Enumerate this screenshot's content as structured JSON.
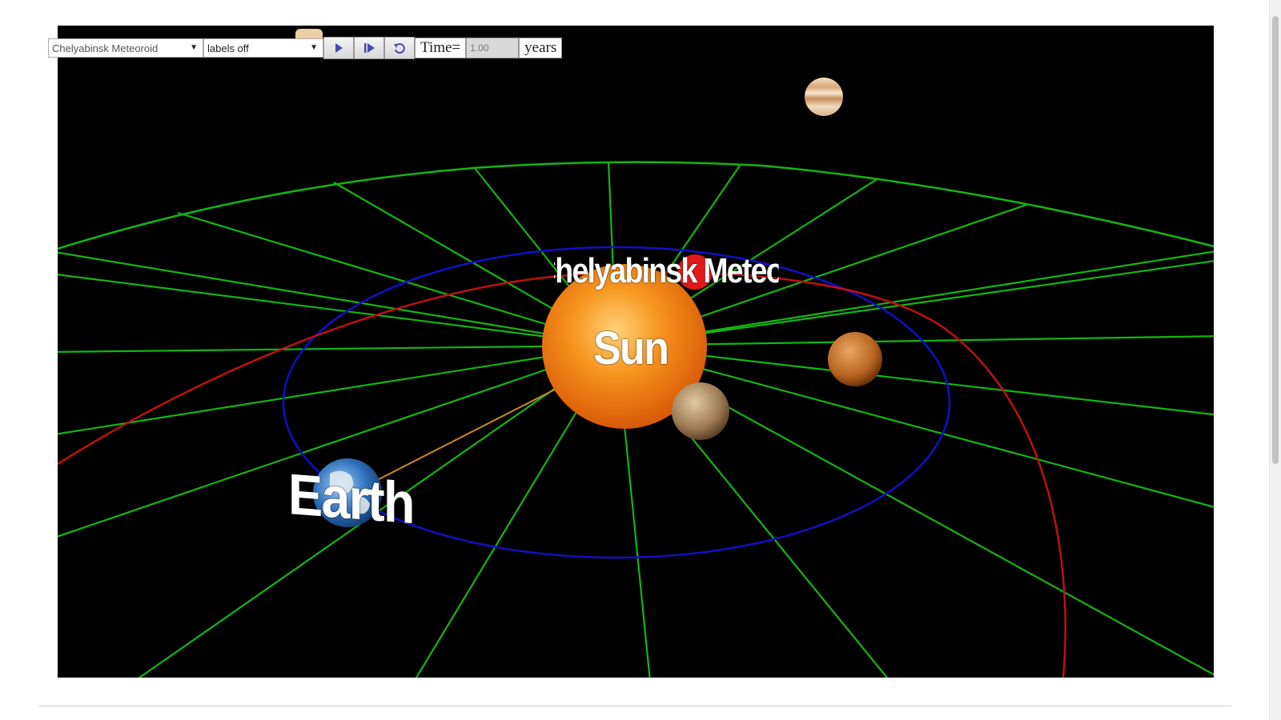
{
  "toolbar": {
    "body_select": {
      "value": "Chelyabinsk Meteoroid"
    },
    "labels_select": {
      "value": "labels off"
    },
    "play_icon": "play-icon",
    "step_icon": "step-icon",
    "reset_icon": "reset-icon",
    "time_label": "Time=",
    "time_value": "1.00",
    "time_unit": "years"
  },
  "scene": {
    "labels": {
      "sun": "Sun",
      "earth": "Earth",
      "meteoroid": "Chelyabinsk Meteoroid"
    },
    "colors": {
      "background": "#000000",
      "ecliptic_grid": "#13b513",
      "earth_orbit": "#1010c8",
      "meteoroid_orbit": "#c01010",
      "sun_earth_line": "#c88a20",
      "sun": "#f07a18"
    }
  }
}
